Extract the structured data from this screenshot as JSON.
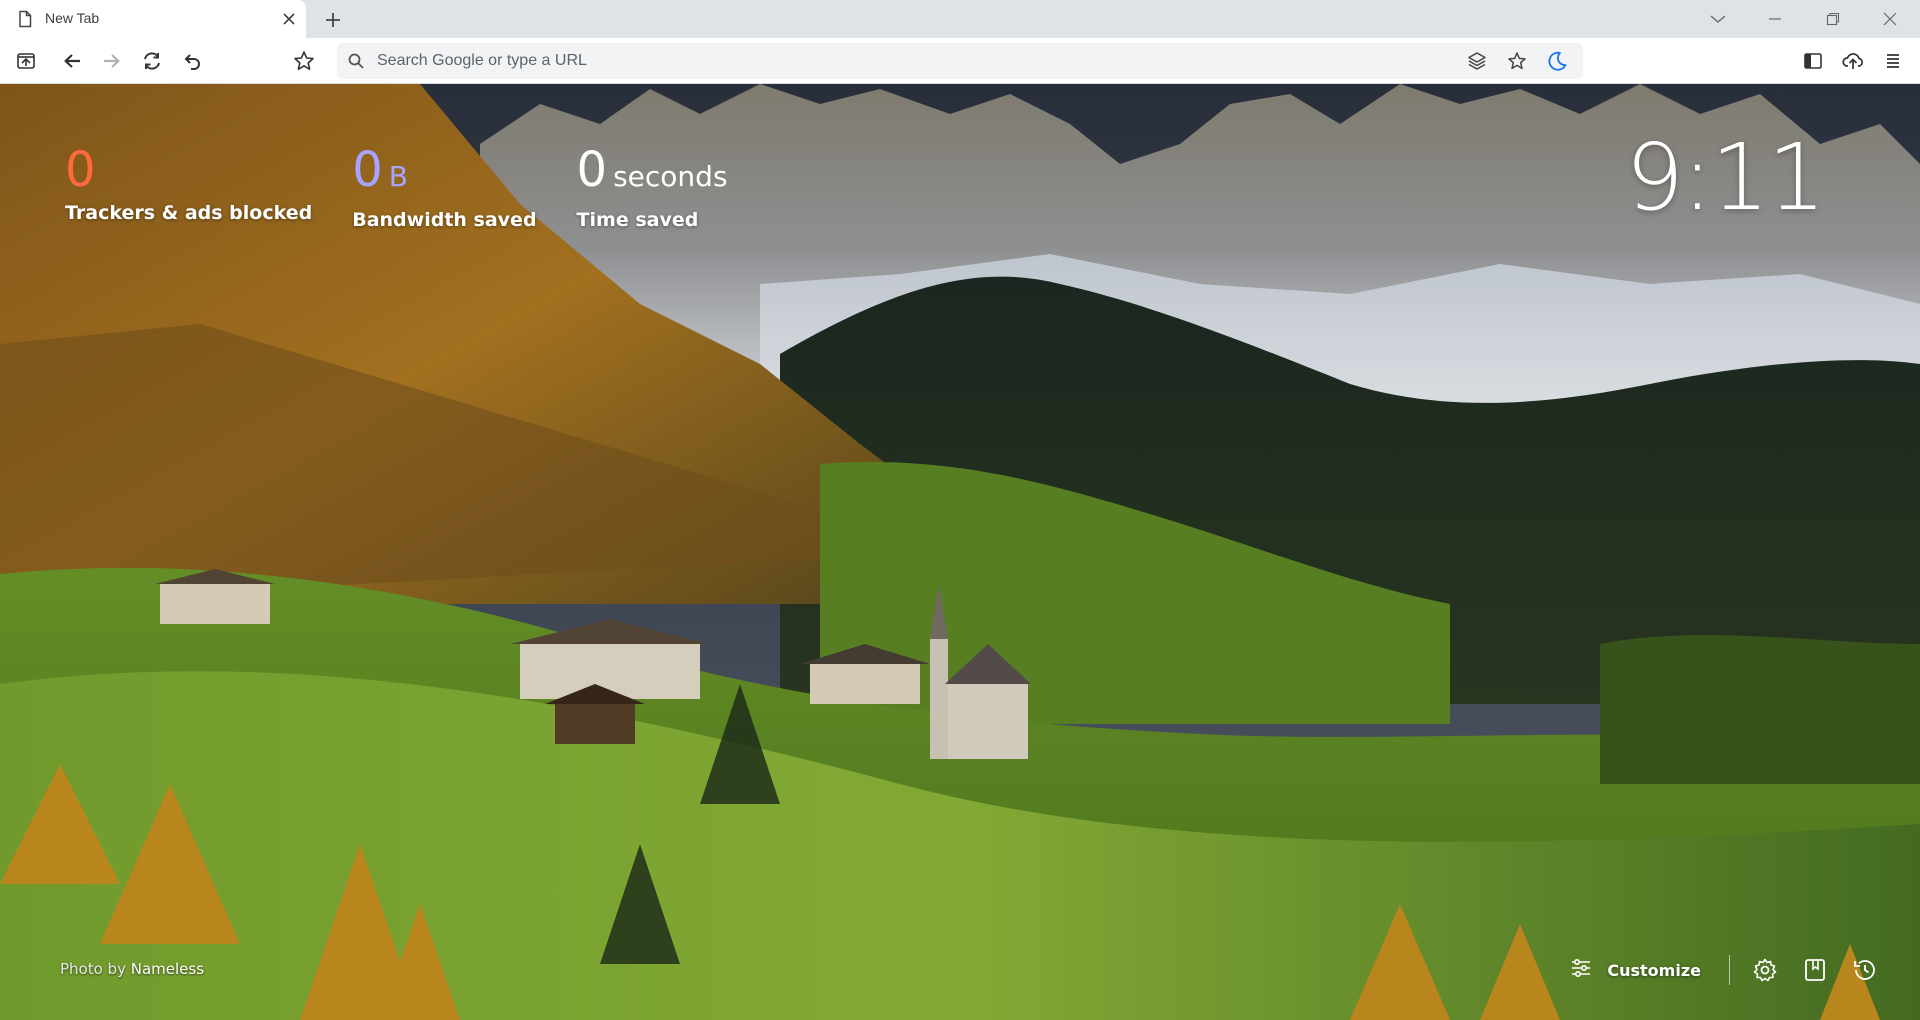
{
  "tab": {
    "title": "New Tab"
  },
  "toolbar": {
    "search_placeholder": "Search Google or type a URL"
  },
  "stats": [
    {
      "value": "0",
      "unit": "",
      "label": "Trackers & ads blocked",
      "color": "#ff6a3d"
    },
    {
      "value": "0",
      "unit": "B",
      "label": "Bandwidth saved",
      "color": "#a8a3ff"
    },
    {
      "value": "0",
      "unit": "seconds",
      "label": "Time saved",
      "color": "#ffffff"
    }
  ],
  "clock": "9:11",
  "credit": {
    "prefix": "Photo by",
    "author": "Nameless"
  },
  "bottom": {
    "customize_label": "Customize"
  },
  "icons": {
    "tab": "page-icon",
    "close": "close-icon",
    "new_tab": "plus-icon",
    "bookmark": "star-outline-icon",
    "search": "search-icon",
    "leo": "layers-icon",
    "favorite": "star-icon",
    "night": "moon-icon",
    "sidebar": "sidebar-icon",
    "upload": "cloud-upload-icon",
    "menu": "menu-icon",
    "settings": "gear-icon",
    "bookmarks": "bookmark-icon",
    "history": "history-icon",
    "customize": "sliders-icon"
  },
  "colors": {
    "accent_moon": "#1a73e8",
    "trackers": "#ff6a3d",
    "bandwidth": "#a8a3ff"
  }
}
